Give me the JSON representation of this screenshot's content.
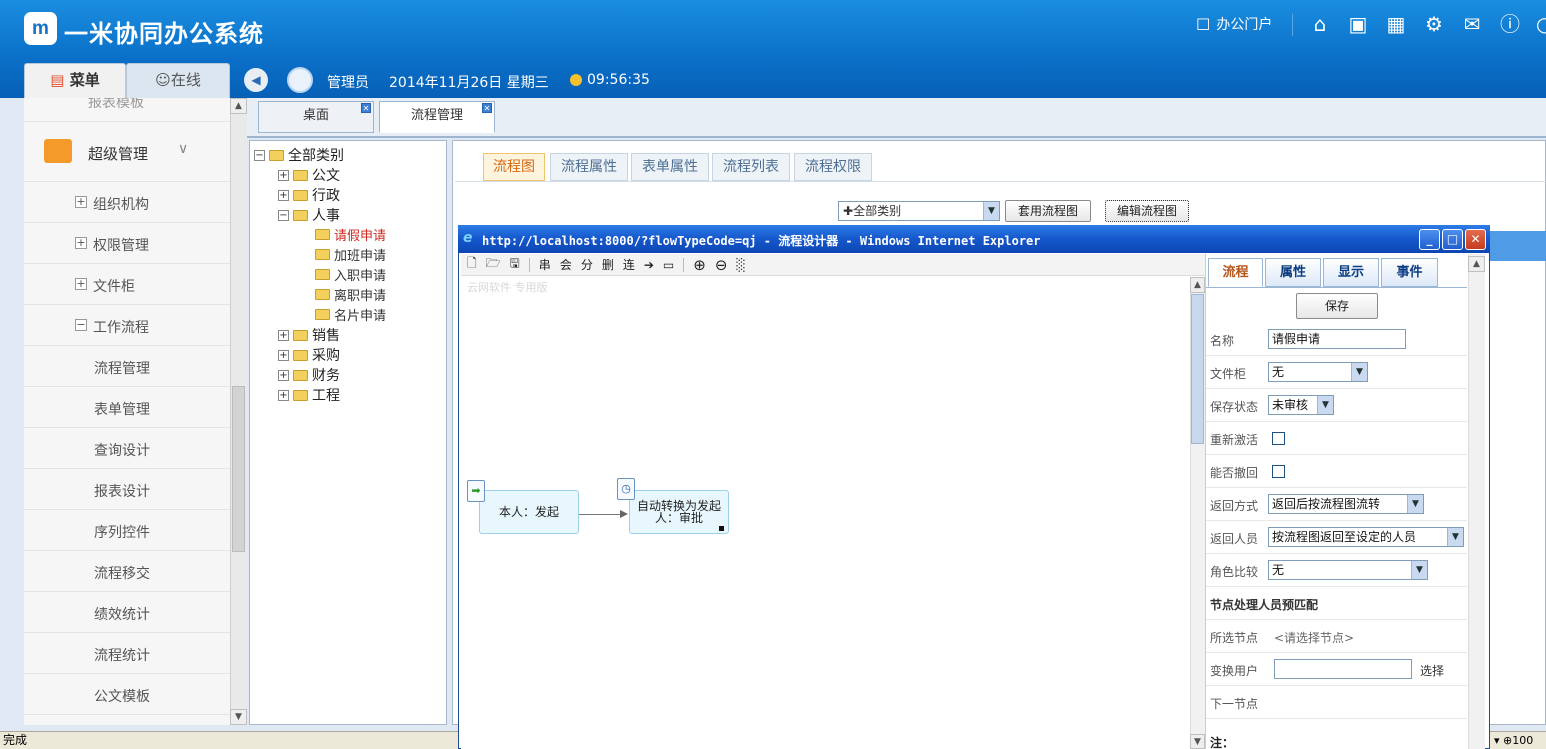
{
  "header": {
    "logo_text": "m",
    "title": "一米协同办公系统",
    "portal_label": "办公门户",
    "tab_menu": "菜单",
    "tab_online": "在线",
    "user": "管理员",
    "date": "2014年11月26日 星期三",
    "time": "09:56:35"
  },
  "sidebar": {
    "partial_item": "报表模板",
    "group": "超级管理",
    "items": [
      {
        "label": "组织机构",
        "expand": "+"
      },
      {
        "label": "权限管理",
        "expand": "+"
      },
      {
        "label": "文件柜",
        "expand": "+"
      },
      {
        "label": "工作流程",
        "expand": "−"
      }
    ],
    "subitems": [
      "流程管理",
      "表单管理",
      "查询设计",
      "报表设计",
      "序列控件",
      "流程移交",
      "绩效统计",
      "流程统计",
      "公文模板"
    ]
  },
  "content_tabs": [
    "桌面",
    "流程管理"
  ],
  "tree": {
    "root": "全部类别",
    "nodes": [
      "公文",
      "行政",
      "人事",
      "销售",
      "采购",
      "财务",
      "工程"
    ],
    "hr_children": [
      "请假申请",
      "加班申请",
      "入职申请",
      "离职申请",
      "名片申请"
    ]
  },
  "main_tabs": [
    "流程图",
    "流程属性",
    "表单属性",
    "流程列表",
    "流程权限"
  ],
  "toolbar": {
    "category_select": "全部类别",
    "apply_button": "套用流程图",
    "edit_button": "编辑流程图"
  },
  "ie": {
    "title": "http://localhost:8000/?flowTypeCode=qj - 流程设计器 - Windows Internet Explorer",
    "watermark": "云网软件 专用版",
    "tools": [
      "串",
      "会",
      "分",
      "删",
      "连"
    ]
  },
  "nodes": {
    "start": "本人：发起",
    "approve": "自动转换为发起人：审批"
  },
  "props": {
    "tabs": [
      "流程",
      "属性",
      "显示",
      "事件"
    ],
    "save": "保存",
    "name_label": "名称",
    "name_value": "请假申请",
    "cabinet_label": "文件柜",
    "cabinet_value": "无",
    "save_state_label": "保存状态",
    "save_state_value": "未审核",
    "reactivate_label": "重新激活",
    "revoke_label": "能否撤回",
    "return_mode_label": "返回方式",
    "return_mode_value": "返回后按流程图流转",
    "return_user_label": "返回人员",
    "return_user_value": "按流程图返回至设定的人员",
    "role_compare_label": "角色比较",
    "role_compare_value": "无",
    "section_title": "节点处理人员预匹配",
    "selected_node_label": "所选节点",
    "selected_node_value": "<请选择节点>",
    "switch_user_label": "变换用户",
    "select_link": "选择",
    "next_node_label": "下一节点",
    "note_label": "注："
  },
  "status": {
    "left": "完成",
    "right": "100"
  }
}
